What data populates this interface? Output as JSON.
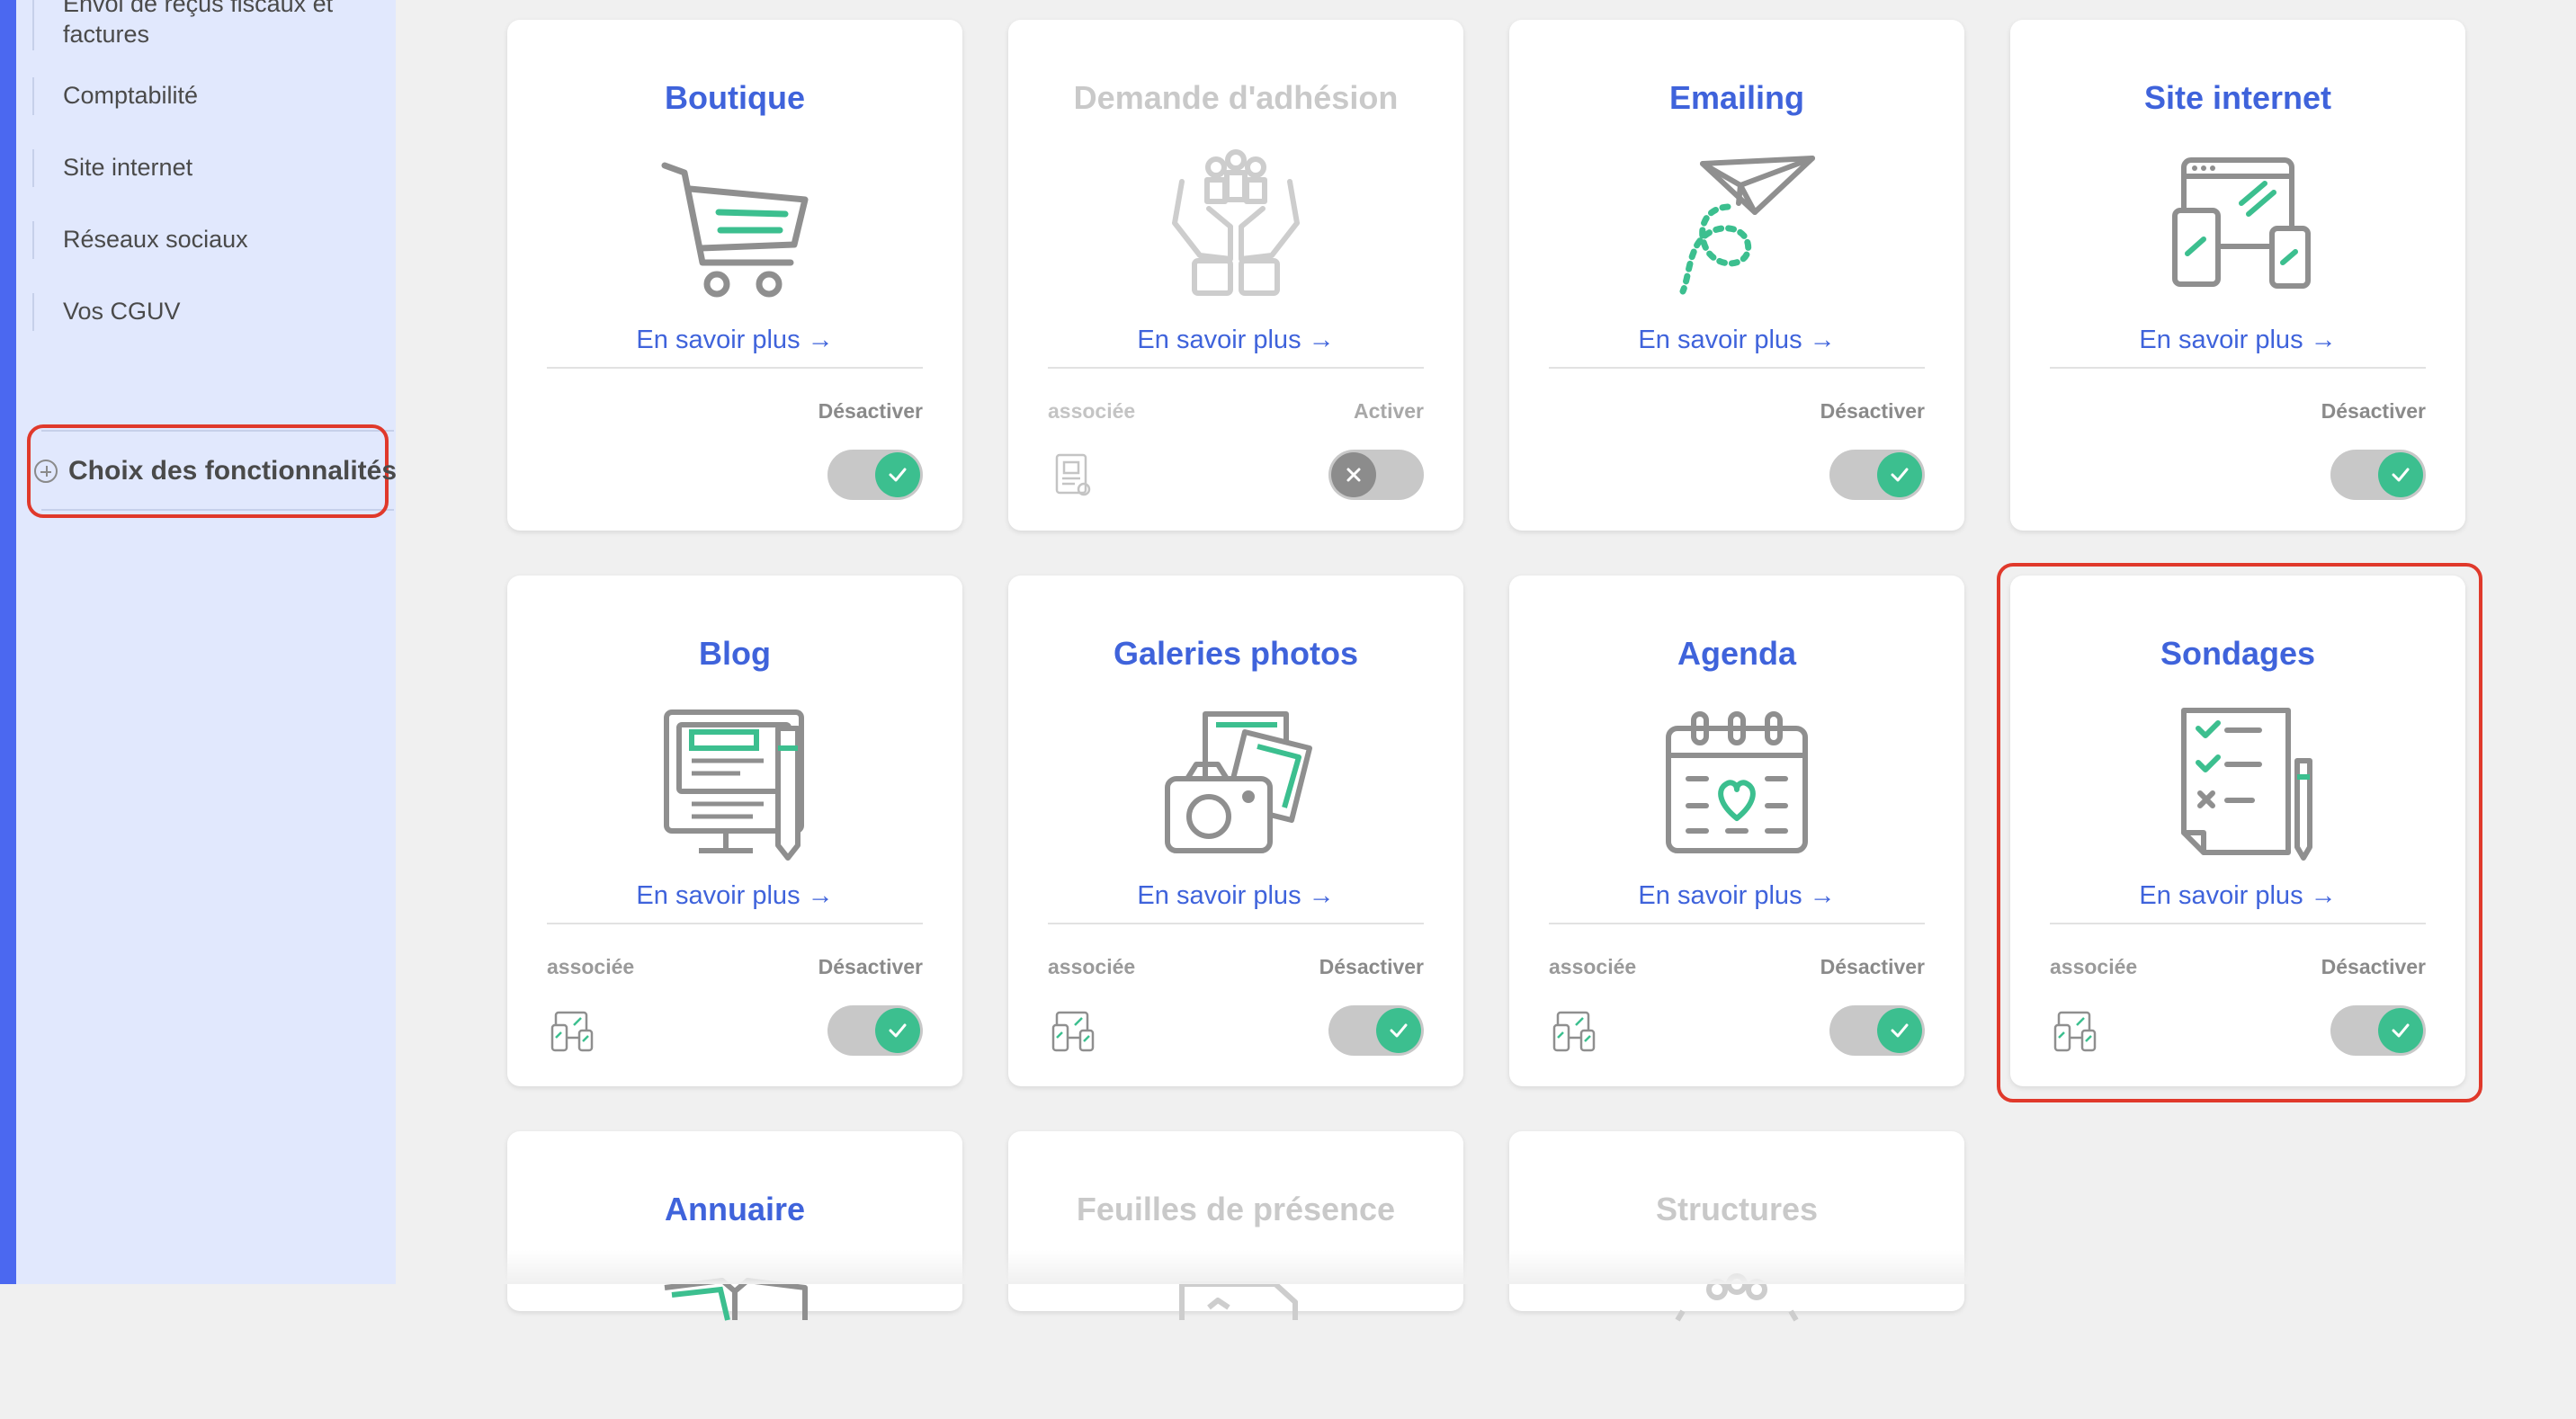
{
  "sidebar": {
    "items": [
      {
        "label": "Envoi de reçus fiscaux et"
      },
      {
        "label": "factures"
      },
      {
        "label": "Comptabilité"
      },
      {
        "label": "Site internet"
      },
      {
        "label": "Réseaux sociaux"
      },
      {
        "label": "Vos CGUV"
      }
    ],
    "choice_label": "Choix des fonctionnalités"
  },
  "learn_more": "En savoir plus",
  "arrow": "→",
  "cards": [
    {
      "title": "Boutique",
      "assoc": "",
      "status": "Désactiver",
      "enabled": true,
      "icon": "cart-icon"
    },
    {
      "title": "Demande d'adhésion",
      "assoc": "associée",
      "status": "Activer",
      "enabled": false,
      "icon": "hands-people-icon"
    },
    {
      "title": "Emailing",
      "assoc": "",
      "status": "Désactiver",
      "enabled": true,
      "icon": "paper-plane-icon"
    },
    {
      "title": "Site internet",
      "assoc": "",
      "status": "Désactiver",
      "enabled": true,
      "icon": "devices-icon"
    },
    {
      "title": "Blog",
      "assoc": "associée",
      "status": "Désactiver",
      "enabled": true,
      "icon": "blog-icon"
    },
    {
      "title": "Galeries photos",
      "assoc": "associée",
      "status": "Désactiver",
      "enabled": true,
      "icon": "camera-photos-icon"
    },
    {
      "title": "Agenda",
      "assoc": "associée",
      "status": "Désactiver",
      "enabled": true,
      "icon": "calendar-icon"
    },
    {
      "title": "Sondages",
      "assoc": "associée",
      "status": "Désactiver",
      "enabled": true,
      "icon": "survey-icon"
    },
    {
      "title": "Annuaire",
      "icon": "directory-icon"
    },
    {
      "title": "Feuilles de présence",
      "icon": "attendance-icon"
    },
    {
      "title": "Structures",
      "icon": "structures-icon"
    }
  ],
  "colors": {
    "accent_blue": "#3f63db",
    "sidebar_bg": "#e1e8fd",
    "toggle_green": "#3cbf8f",
    "highlight_red": "#e0392b"
  }
}
